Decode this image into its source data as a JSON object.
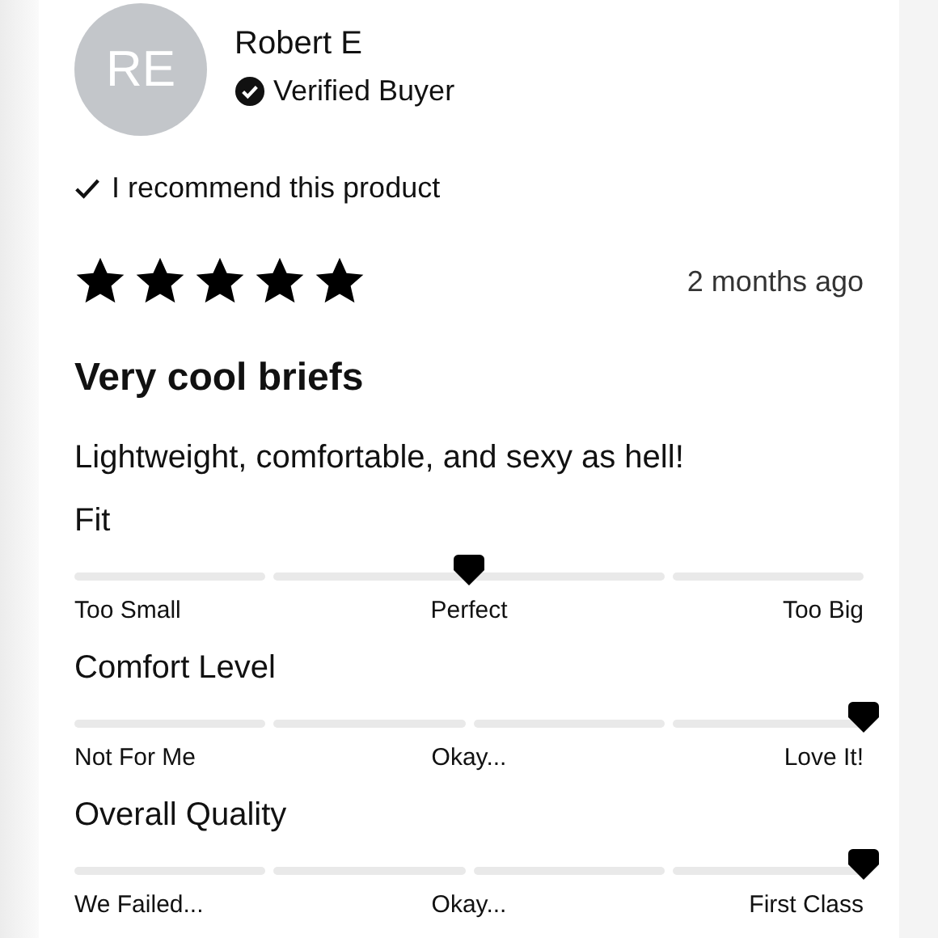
{
  "reviewer": {
    "initials": "RE",
    "name": "Robert E",
    "badge": "Verified Buyer"
  },
  "recommendation": "I recommend this product",
  "rating": {
    "stars": 5,
    "date": "2 months ago"
  },
  "title": "Very cool briefs",
  "body": "Lightweight, comfortable, and sexy as hell!",
  "scales": [
    {
      "label": "Fit",
      "level": 0.5,
      "marks": [
        "Too Small",
        "Perfect",
        "Too Big"
      ]
    },
    {
      "label": "Comfort Level",
      "level": 1,
      "marks": [
        "Not For Me",
        "Okay...",
        "Love It!"
      ]
    },
    {
      "label": "Overall Quality",
      "level": 1,
      "marks": [
        "We Failed...",
        "Okay...",
        "First Class"
      ]
    }
  ]
}
